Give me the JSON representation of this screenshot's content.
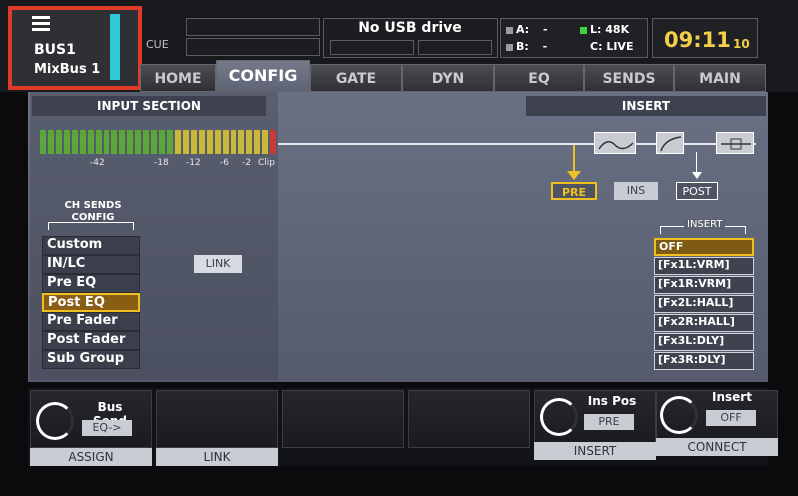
{
  "channel": {
    "name": "BUS1",
    "sub": "MixBus 1",
    "cue_label": "CUE"
  },
  "usb": {
    "status": "No USB drive"
  },
  "status": {
    "a_label": "A:",
    "a_value": "-",
    "b_label": "B:",
    "b_value": "-",
    "l_label": "L:",
    "l_value": "48K",
    "c_label": "C:",
    "c_value": "LIVE"
  },
  "clock": {
    "hm": "09:11",
    "sec": "10"
  },
  "tabs": [
    {
      "label": "HOME"
    },
    {
      "label": "CONFIG"
    },
    {
      "label": "GATE"
    },
    {
      "label": "DYN"
    },
    {
      "label": "EQ"
    },
    {
      "label": "SENDS"
    },
    {
      "label": "MAIN"
    }
  ],
  "input_section": {
    "title": "INPUT SECTION",
    "meter_scale": [
      "-42",
      "-18",
      "-12",
      "-6",
      "-2",
      "Clip"
    ],
    "ch_sends_title": "CH SENDS",
    "ch_sends_sub": "CONFIG",
    "ch_sends_options": [
      "Custom",
      "IN/LC",
      "Pre EQ",
      "Post EQ",
      "Pre Fader",
      "Post Fader",
      "Sub Group"
    ],
    "ch_sends_selected": "Post EQ",
    "link_label": "LINK"
  },
  "insert_section": {
    "title": "INSERT",
    "pos_pre": "PRE",
    "pos_ins": "INS",
    "pos_post": "POST",
    "list_label": "INSERT",
    "options": [
      "OFF",
      "[Fx1L:VRM]",
      "[Fx1R:VRM]",
      "[Fx2L:HALL]",
      "[Fx2R:HALL]",
      "[Fx3L:DLY]",
      "[Fx3R:DLY]"
    ],
    "selected": "OFF"
  },
  "encoders": {
    "bus_send": {
      "title": "Bus Send",
      "value": "EQ->",
      "footer": "ASSIGN"
    },
    "link": {
      "footer": "LINK"
    },
    "ins_pos": {
      "title": "Ins Pos",
      "value": "PRE",
      "footer": "INSERT"
    },
    "insert": {
      "title": "Insert",
      "value": "OFF",
      "footer": "CONNECT"
    }
  },
  "colors": {
    "accent": "#f0c020",
    "alert_box": "#e23a2a",
    "bus_color": "#2ec9d6",
    "clock": "#f4d04a"
  }
}
